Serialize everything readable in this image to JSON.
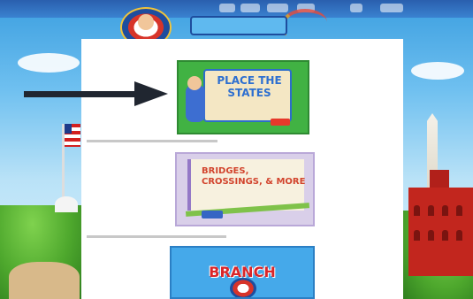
{
  "site": {
    "logo_text": "",
    "banner_text": ""
  },
  "games": [
    {
      "title": "PLACE THE STATES"
    },
    {
      "title": "BRIDGES, CROSSINGS, & MORE"
    },
    {
      "title": "BRANCH",
      "top_label": ""
    }
  ],
  "colors": {
    "panel": "#ffffff",
    "arrow": "#202630",
    "sky": "#3c9fe0"
  },
  "icons": [
    "arrow-right-icon",
    "us-flag-icon",
    "washington-monument-icon",
    "castle-icon",
    "logo-seal-icon"
  ]
}
